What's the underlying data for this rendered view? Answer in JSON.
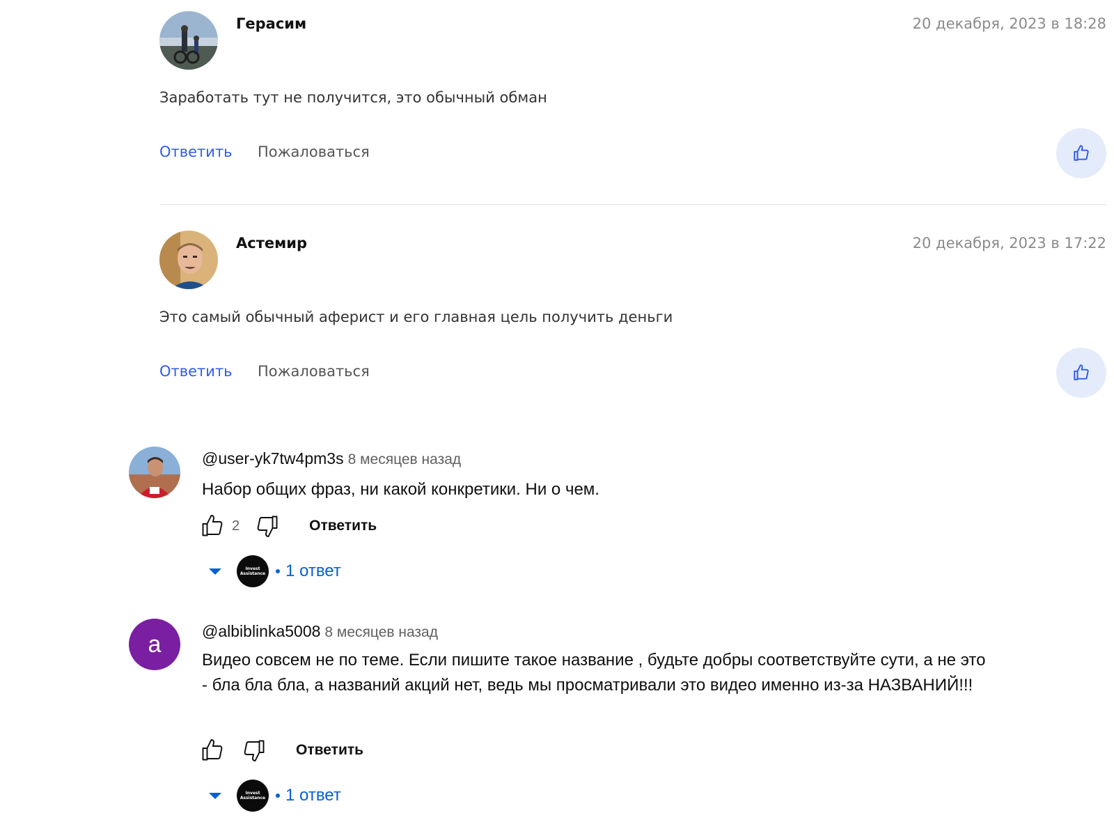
{
  "site_comments": [
    {
      "author": "Герасим",
      "date": "20 декабря, 2023 в 18:28",
      "text": "Заработать тут не получится, это обычный обман",
      "reply_label": "Ответить",
      "report_label": "Пожаловаться",
      "like_icon": "thumbs-up-icon"
    },
    {
      "author": "Астемир",
      "date": "20 декабря, 2023 в 17:22",
      "text": "Это самый обычный аферист и его главная цель получить деньги",
      "reply_label": "Ответить",
      "report_label": "Пожаловаться",
      "like_icon": "thumbs-up-icon"
    }
  ],
  "yt_comments": [
    {
      "handle": "@user-yk7tw4pm3s",
      "time_ago": "8 месяцев назад",
      "text": "Набор общих фраз, ни какой конкретики. Ни о чем.",
      "likes": "2",
      "reply_label": "Ответить",
      "replies_label": "1 ответ",
      "reply_avatar_text": "Invest Assistance"
    },
    {
      "handle": "@albiblinka5008",
      "avatar_letter": "a",
      "time_ago": "8 месяцев назад",
      "text": "Видео совсем не по теме. Если пишите такое название , будьте добры соответствуйте сути, а не это - бла бла бла, а названий акций нет, ведь мы просматривали это видео именно из-за НАЗВАНИЙ!!!",
      "likes": "",
      "reply_label": "Ответить",
      "replies_label": "1 ответ",
      "reply_avatar_text": "Invest Assistance"
    }
  ],
  "colors": {
    "site_link": "#2f5bea",
    "like_bg": "#e4ecfb",
    "yt_blue": "#065fd4",
    "letter_avatar": "#7b1fa2"
  }
}
